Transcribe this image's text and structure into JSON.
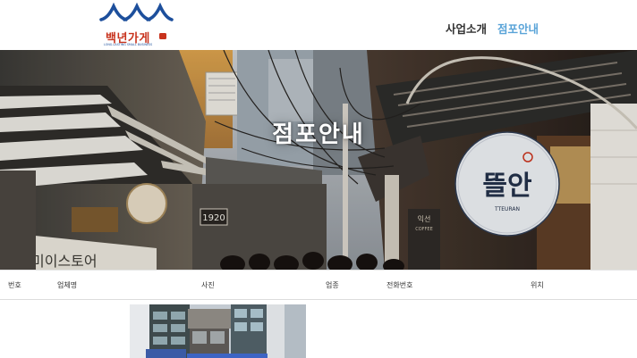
{
  "site": {
    "logo_text": "백년가게",
    "logo_badge": "",
    "logo_tagline": "LONG-LASTING SMALL BUSINESS",
    "colors": {
      "brand_blue": "#1d4f9c",
      "accent_red": "#c8331d",
      "nav_active": "#5aa4d8",
      "nav_text": "#333333"
    }
  },
  "nav": {
    "items": [
      {
        "label": "사업소개",
        "active": false
      },
      {
        "label": "점포안내",
        "active": true
      }
    ]
  },
  "hero": {
    "title": "점포안내",
    "signs": {
      "year": "1920",
      "cafe_name": "뜰안",
      "cafe_roman": "TTEURAN",
      "shop_label": "익선",
      "shop_sub": "COFFEE",
      "storefront": "미이스토어"
    }
  },
  "table": {
    "columns": [
      "번호",
      "업체명",
      "사진",
      "업종",
      "전화번호",
      "위치"
    ]
  }
}
